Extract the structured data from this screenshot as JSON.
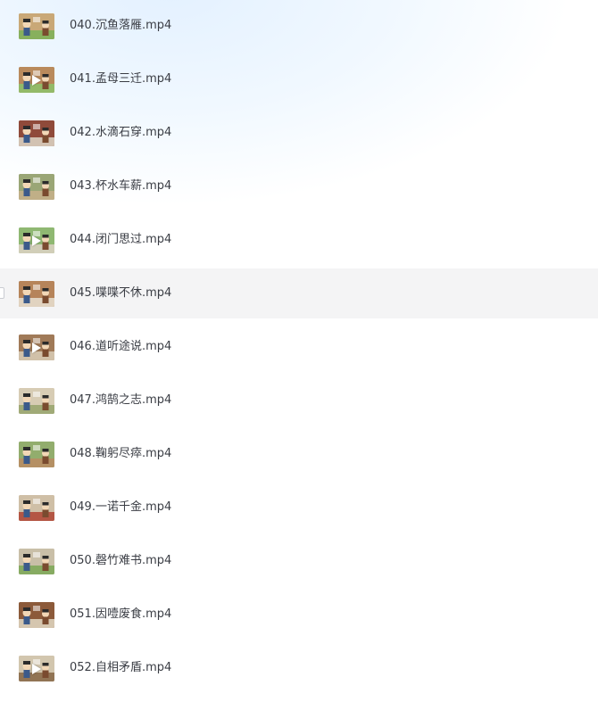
{
  "files": [
    {
      "name": "040.沉鱼落雁.mp4",
      "thumb_bg": "#c9a877",
      "thumb_accent": "#7fb05a",
      "play_icon": false
    },
    {
      "name": "041.孟母三迁.mp4",
      "thumb_bg": "#b98a5c",
      "thumb_accent": "#8fbf6a",
      "play_icon": true
    },
    {
      "name": "042.水滴石穿.mp4",
      "thumb_bg": "#8f4a3a",
      "thumb_accent": "#d9cfc0",
      "play_icon": false
    },
    {
      "name": "043.杯水车薪.mp4",
      "thumb_bg": "#9aa676",
      "thumb_accent": "#c4b08a",
      "play_icon": false
    },
    {
      "name": "044.闭门思过.mp4",
      "thumb_bg": "#8fb872",
      "thumb_accent": "#d8d0c0",
      "play_icon": true
    },
    {
      "name": "045.喋喋不休.mp4",
      "thumb_bg": "#b6845a",
      "thumb_accent": "#e5dccb",
      "play_icon": false
    },
    {
      "name": "046.道听途说.mp4",
      "thumb_bg": "#a07a58",
      "thumb_accent": "#d6c9b2",
      "play_icon": true
    },
    {
      "name": "047.鸿鹄之志.mp4",
      "thumb_bg": "#d7ccb4",
      "thumb_accent": "#9aa670",
      "play_icon": false
    },
    {
      "name": "048.鞠躬尽瘁.mp4",
      "thumb_bg": "#92ad6d",
      "thumb_accent": "#b98d63",
      "play_icon": false
    },
    {
      "name": "049.一诺千金.mp4",
      "thumb_bg": "#cfbfa6",
      "thumb_accent": "#b04a3a",
      "play_icon": false
    },
    {
      "name": "050.磬竹难书.mp4",
      "thumb_bg": "#c9bfa8",
      "thumb_accent": "#7fa95a",
      "play_icon": false
    },
    {
      "name": "051.因噎废食.mp4",
      "thumb_bg": "#8c5a3a",
      "thumb_accent": "#ddd1bc",
      "play_icon": false
    },
    {
      "name": "052.自相矛盾.mp4",
      "thumb_bg": "#d2c6ae",
      "thumb_accent": "#8a6a4a",
      "play_icon": true
    }
  ],
  "hovered_index": 5,
  "colors": {
    "text": "#3a3d44",
    "hover_row": "#f4f4f5",
    "background_glow": "#e2f0ff"
  },
  "icons": {
    "thumbnail": "video-thumbnail-icon",
    "play": "play-icon",
    "checkbox": "checkbox-icon"
  }
}
